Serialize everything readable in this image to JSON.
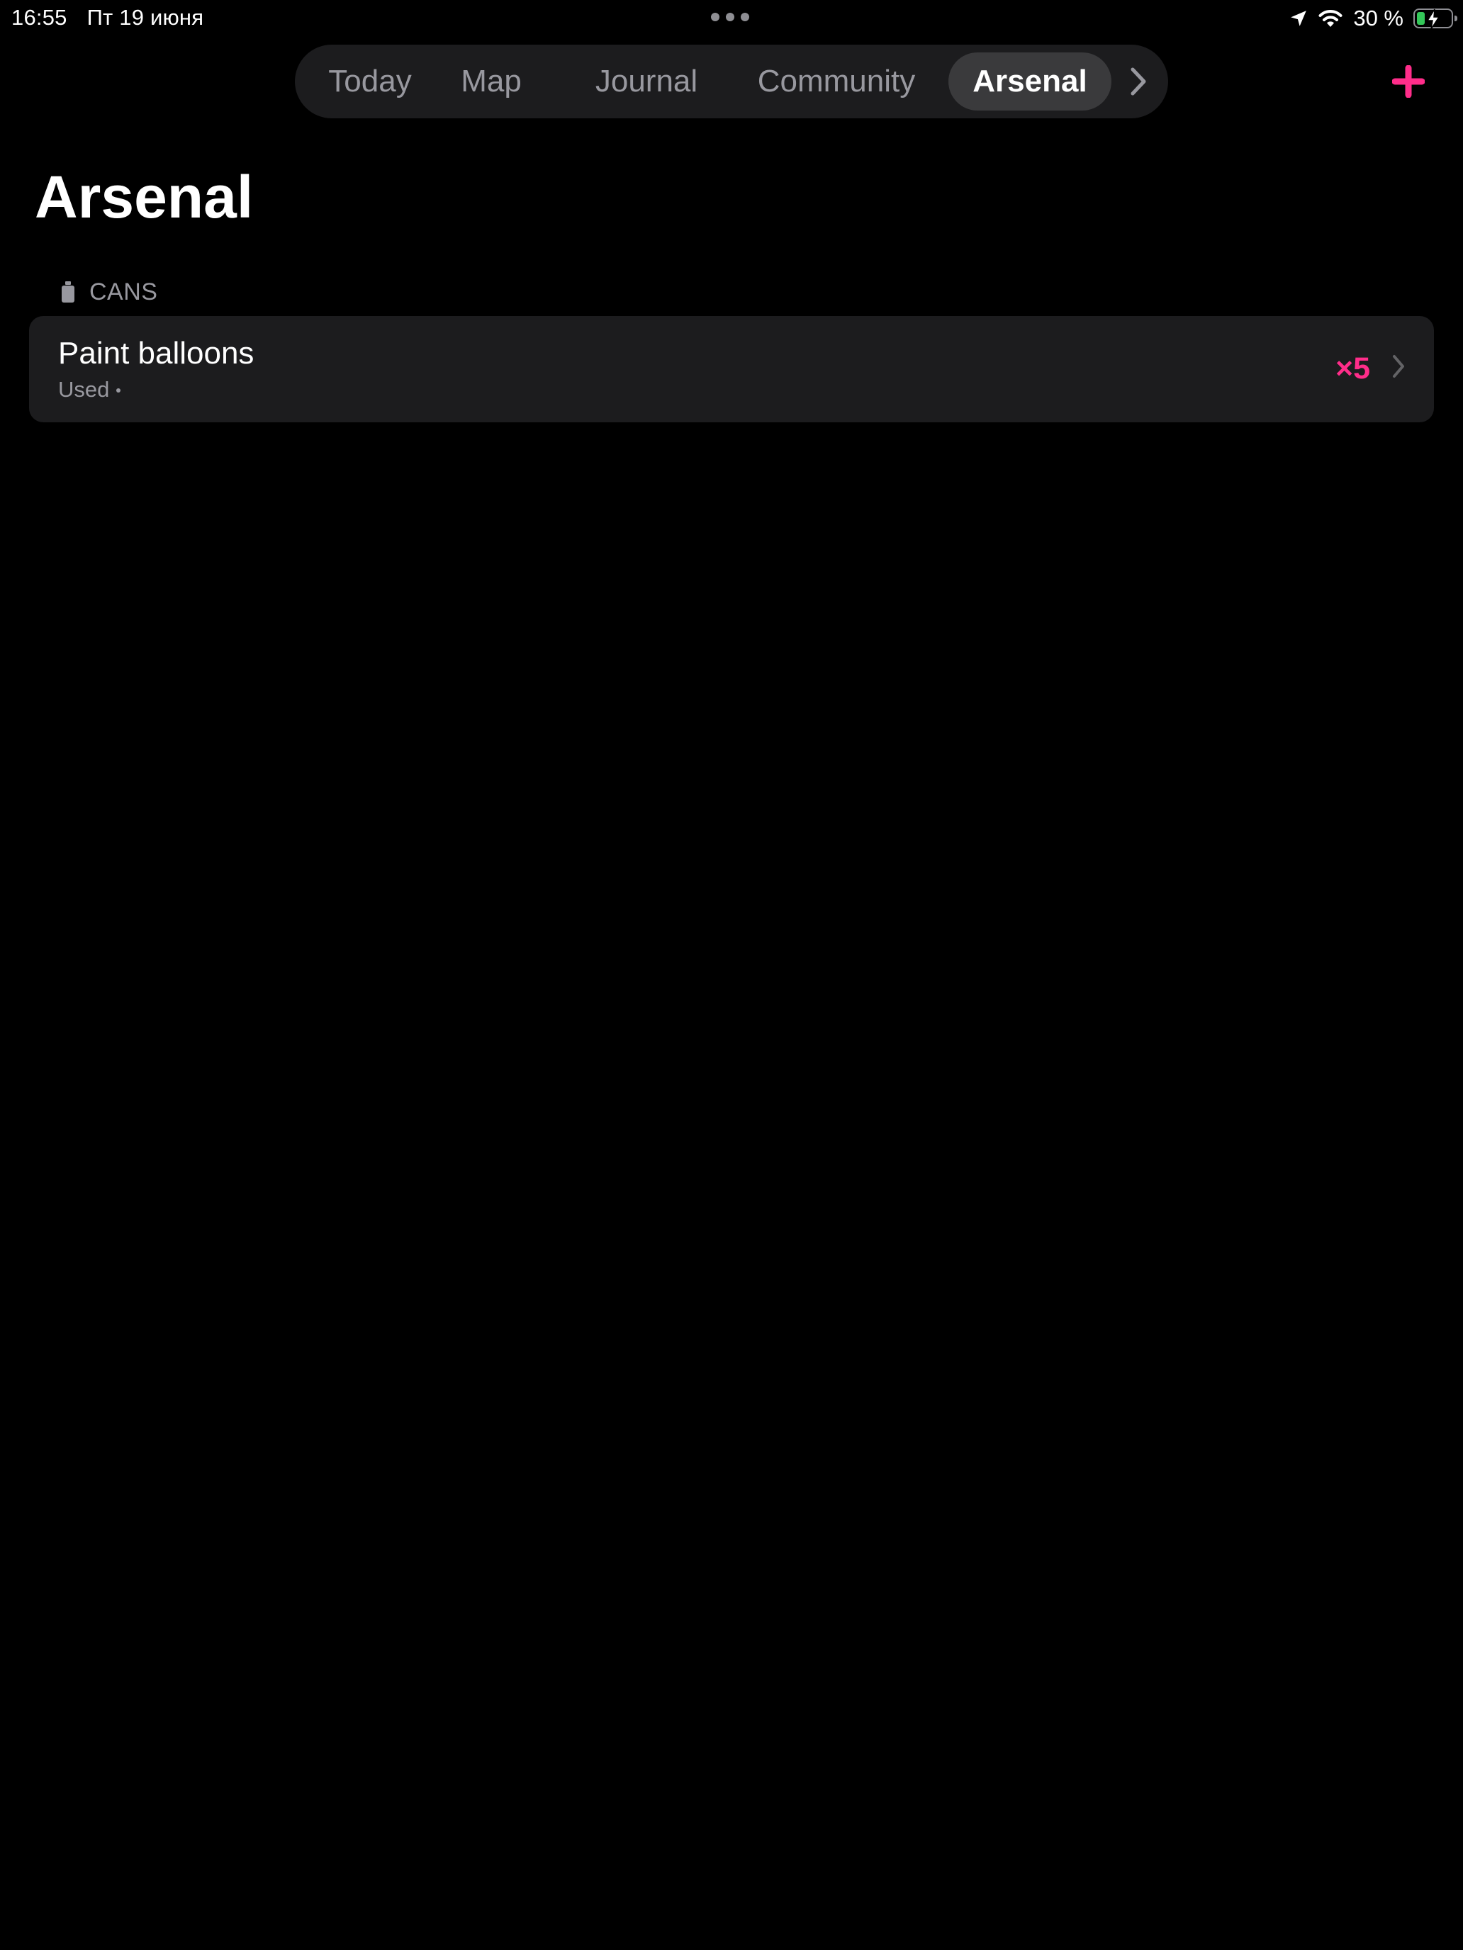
{
  "status_bar": {
    "time": "16:55",
    "date": "Пт 19 июня",
    "battery_percent": "30 %",
    "battery_level": 0.3,
    "charging": true,
    "icons": [
      "location-arrow-icon",
      "wifi-icon",
      "battery-charging-icon"
    ]
  },
  "tabs": [
    {
      "label": "Today",
      "active": false
    },
    {
      "label": "Map",
      "active": false
    },
    {
      "label": "Journal",
      "active": false
    },
    {
      "label": "Community",
      "active": false
    },
    {
      "label": "Arsenal",
      "active": true
    }
  ],
  "tab_overflow_icon": "chevron-right-icon",
  "add_icon": "plus-icon",
  "page": {
    "title": "Arsenal"
  },
  "section": {
    "icon": "spray-can-icon",
    "label": "CANS"
  },
  "items": [
    {
      "title": "Paint balloons",
      "subtitle": "Used",
      "count": "×5"
    }
  ],
  "colors": {
    "accent": "#ff2d8a",
    "background": "#000000",
    "card": "#1c1c1e",
    "selected_tab": "#3a3a3c",
    "secondary_text": "#98989f",
    "battery_fill": "#34c759"
  }
}
